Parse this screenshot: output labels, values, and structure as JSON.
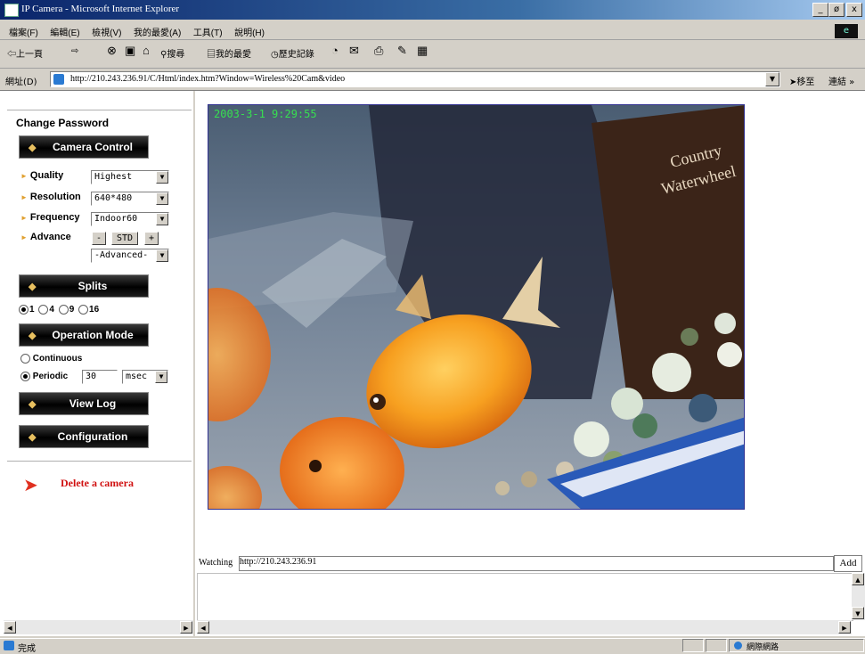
{
  "window": {
    "title": "IP Camera - Microsoft Internet Explorer",
    "buttons": [
      "_",
      "ø",
      "x"
    ]
  },
  "menu": [
    "檔案(F)",
    "編輯(E)",
    "檢視(V)",
    "我的最愛(A)",
    "工具(T)",
    "說明(H)"
  ],
  "toolbar": {
    "back": "⇦上一頁",
    "search": "搜尋",
    "favorites": "我的最愛",
    "history": "歷史記錄"
  },
  "address": {
    "label": "網址(D)",
    "url": "http://210.243.236.91/C/Html/index.htm?Window=Wireless%20Cam&video",
    "go": "移至",
    "links": "連結 »"
  },
  "sidebar": {
    "change_password": "Change Password",
    "camera_control": "Camera Control",
    "quality_label": "Quality",
    "quality_value": "Highest",
    "resolution_label": "Resolution",
    "resolution_value": "640*480",
    "frequency_label": "Frequency",
    "frequency_value": "Indoor60",
    "advance_label": "Advance",
    "adv_minus": "-",
    "adv_std": "STD",
    "adv_plus": "+",
    "advanced_value": "-Advanced-",
    "splits": "Splits",
    "split_options": [
      "1",
      "4",
      "9",
      "16"
    ],
    "split_selected": "1",
    "operation_mode": "Operation Mode",
    "mode_continuous": "Continuous",
    "mode_periodic": "Periodic",
    "mode_selected": "Periodic",
    "periodic_value": "30",
    "periodic_unit": "msec",
    "view_log": "View Log",
    "configuration": "Configuration",
    "delete_camera": "Delete a camera"
  },
  "camera": {
    "timestamp": "2003-3-1 9:29:55",
    "box_text": "Country Waterwheel"
  },
  "watching": {
    "label": "Watching",
    "value": "http://210.243.236.91",
    "add": "Add"
  },
  "status": {
    "text": "完成",
    "zone": "網際網路"
  },
  "colors": {
    "title_bar": "#0a246a",
    "timestamp": "#37e050",
    "delete_link": "#d01010",
    "camera_border": "#303090"
  }
}
